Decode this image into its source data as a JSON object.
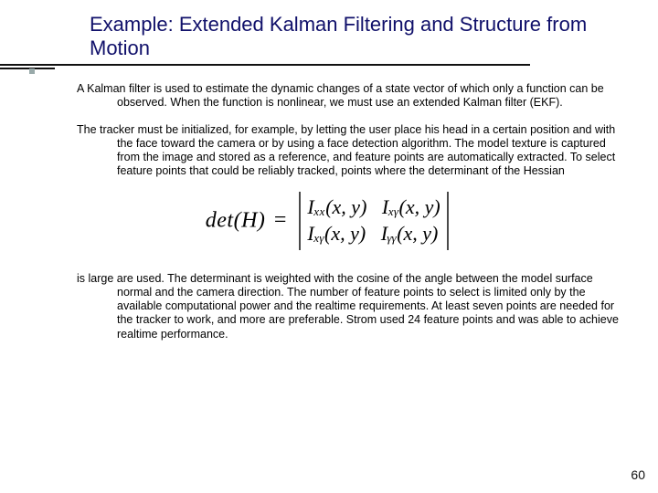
{
  "title": "Example: Extended Kalman Filtering and Structure from Motion",
  "paragraphs": {
    "p1": "A Kalman filter is used to estimate the dynamic changes of a state vector of which only a function can be observed. When the function is nonlinear, we must use an extended Kalman filter (EKF).",
    "p2": "The tracker must be initialized, for example, by letting the user place his head in a certain position and with the face toward the camera or by using a face detection algorithm. The model texture is captured from the image and stored as a reference, and feature points are automatically extracted. To select feature points that could be reliably tracked, points where the determinant of the Hessian",
    "p3": "is large are used. The determinant is weighted with the cosine of the angle between the model surface normal and the camera direction. The number of feature points to select is limited only by the available computational power and the realtime requirements. At least seven points are needed for the tracker to work, and more are preferable. Strom used 24 feature points and was able to achieve realtime performance."
  },
  "formula": {
    "lhs": "det(H)",
    "m11": "Iₓₓ(x, y)",
    "m12": "Iₓᵧ(x, y)",
    "m21": "Iₓᵧ(x, y)",
    "m22": "Iᵧᵧ(x, y)"
  },
  "page_number": "60"
}
